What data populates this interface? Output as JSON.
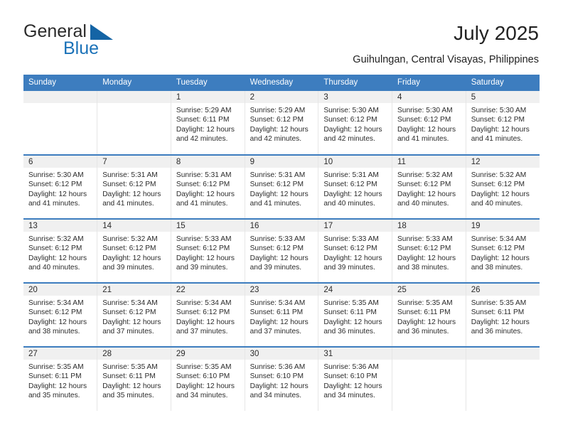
{
  "brand": {
    "name_part1": "General",
    "name_part2": "Blue",
    "triangle_color": "#1464a5",
    "blue": "#1b72b8"
  },
  "header": {
    "title": "July 2025",
    "subtitle": "Guihulngan, Central Visayas, Philippines"
  },
  "theme": {
    "header_blue": "#3d7dbf",
    "daynum_strip": "#f0f0f0",
    "text": "#2b2b2b"
  },
  "weekdays": [
    "Sunday",
    "Monday",
    "Tuesday",
    "Wednesday",
    "Thursday",
    "Friday",
    "Saturday"
  ],
  "labels": {
    "sunrise": "Sunrise:",
    "sunset": "Sunset:",
    "daylight": "Daylight:"
  },
  "weeks": [
    [
      {
        "day": "",
        "sunrise": "",
        "sunset": "",
        "daylight1": "",
        "daylight2": ""
      },
      {
        "day": "",
        "sunrise": "",
        "sunset": "",
        "daylight1": "",
        "daylight2": ""
      },
      {
        "day": "1",
        "sunrise": "Sunrise: 5:29 AM",
        "sunset": "Sunset: 6:11 PM",
        "daylight1": "Daylight: 12 hours",
        "daylight2": "and 42 minutes."
      },
      {
        "day": "2",
        "sunrise": "Sunrise: 5:29 AM",
        "sunset": "Sunset: 6:12 PM",
        "daylight1": "Daylight: 12 hours",
        "daylight2": "and 42 minutes."
      },
      {
        "day": "3",
        "sunrise": "Sunrise: 5:30 AM",
        "sunset": "Sunset: 6:12 PM",
        "daylight1": "Daylight: 12 hours",
        "daylight2": "and 42 minutes."
      },
      {
        "day": "4",
        "sunrise": "Sunrise: 5:30 AM",
        "sunset": "Sunset: 6:12 PM",
        "daylight1": "Daylight: 12 hours",
        "daylight2": "and 41 minutes."
      },
      {
        "day": "5",
        "sunrise": "Sunrise: 5:30 AM",
        "sunset": "Sunset: 6:12 PM",
        "daylight1": "Daylight: 12 hours",
        "daylight2": "and 41 minutes."
      }
    ],
    [
      {
        "day": "6",
        "sunrise": "Sunrise: 5:30 AM",
        "sunset": "Sunset: 6:12 PM",
        "daylight1": "Daylight: 12 hours",
        "daylight2": "and 41 minutes."
      },
      {
        "day": "7",
        "sunrise": "Sunrise: 5:31 AM",
        "sunset": "Sunset: 6:12 PM",
        "daylight1": "Daylight: 12 hours",
        "daylight2": "and 41 minutes."
      },
      {
        "day": "8",
        "sunrise": "Sunrise: 5:31 AM",
        "sunset": "Sunset: 6:12 PM",
        "daylight1": "Daylight: 12 hours",
        "daylight2": "and 41 minutes."
      },
      {
        "day": "9",
        "sunrise": "Sunrise: 5:31 AM",
        "sunset": "Sunset: 6:12 PM",
        "daylight1": "Daylight: 12 hours",
        "daylight2": "and 41 minutes."
      },
      {
        "day": "10",
        "sunrise": "Sunrise: 5:31 AM",
        "sunset": "Sunset: 6:12 PM",
        "daylight1": "Daylight: 12 hours",
        "daylight2": "and 40 minutes."
      },
      {
        "day": "11",
        "sunrise": "Sunrise: 5:32 AM",
        "sunset": "Sunset: 6:12 PM",
        "daylight1": "Daylight: 12 hours",
        "daylight2": "and 40 minutes."
      },
      {
        "day": "12",
        "sunrise": "Sunrise: 5:32 AM",
        "sunset": "Sunset: 6:12 PM",
        "daylight1": "Daylight: 12 hours",
        "daylight2": "and 40 minutes."
      }
    ],
    [
      {
        "day": "13",
        "sunrise": "Sunrise: 5:32 AM",
        "sunset": "Sunset: 6:12 PM",
        "daylight1": "Daylight: 12 hours",
        "daylight2": "and 40 minutes."
      },
      {
        "day": "14",
        "sunrise": "Sunrise: 5:32 AM",
        "sunset": "Sunset: 6:12 PM",
        "daylight1": "Daylight: 12 hours",
        "daylight2": "and 39 minutes."
      },
      {
        "day": "15",
        "sunrise": "Sunrise: 5:33 AM",
        "sunset": "Sunset: 6:12 PM",
        "daylight1": "Daylight: 12 hours",
        "daylight2": "and 39 minutes."
      },
      {
        "day": "16",
        "sunrise": "Sunrise: 5:33 AM",
        "sunset": "Sunset: 6:12 PM",
        "daylight1": "Daylight: 12 hours",
        "daylight2": "and 39 minutes."
      },
      {
        "day": "17",
        "sunrise": "Sunrise: 5:33 AM",
        "sunset": "Sunset: 6:12 PM",
        "daylight1": "Daylight: 12 hours",
        "daylight2": "and 39 minutes."
      },
      {
        "day": "18",
        "sunrise": "Sunrise: 5:33 AM",
        "sunset": "Sunset: 6:12 PM",
        "daylight1": "Daylight: 12 hours",
        "daylight2": "and 38 minutes."
      },
      {
        "day": "19",
        "sunrise": "Sunrise: 5:34 AM",
        "sunset": "Sunset: 6:12 PM",
        "daylight1": "Daylight: 12 hours",
        "daylight2": "and 38 minutes."
      }
    ],
    [
      {
        "day": "20",
        "sunrise": "Sunrise: 5:34 AM",
        "sunset": "Sunset: 6:12 PM",
        "daylight1": "Daylight: 12 hours",
        "daylight2": "and 38 minutes."
      },
      {
        "day": "21",
        "sunrise": "Sunrise: 5:34 AM",
        "sunset": "Sunset: 6:12 PM",
        "daylight1": "Daylight: 12 hours",
        "daylight2": "and 37 minutes."
      },
      {
        "day": "22",
        "sunrise": "Sunrise: 5:34 AM",
        "sunset": "Sunset: 6:12 PM",
        "daylight1": "Daylight: 12 hours",
        "daylight2": "and 37 minutes."
      },
      {
        "day": "23",
        "sunrise": "Sunrise: 5:34 AM",
        "sunset": "Sunset: 6:11 PM",
        "daylight1": "Daylight: 12 hours",
        "daylight2": "and 37 minutes."
      },
      {
        "day": "24",
        "sunrise": "Sunrise: 5:35 AM",
        "sunset": "Sunset: 6:11 PM",
        "daylight1": "Daylight: 12 hours",
        "daylight2": "and 36 minutes."
      },
      {
        "day": "25",
        "sunrise": "Sunrise: 5:35 AM",
        "sunset": "Sunset: 6:11 PM",
        "daylight1": "Daylight: 12 hours",
        "daylight2": "and 36 minutes."
      },
      {
        "day": "26",
        "sunrise": "Sunrise: 5:35 AM",
        "sunset": "Sunset: 6:11 PM",
        "daylight1": "Daylight: 12 hours",
        "daylight2": "and 36 minutes."
      }
    ],
    [
      {
        "day": "27",
        "sunrise": "Sunrise: 5:35 AM",
        "sunset": "Sunset: 6:11 PM",
        "daylight1": "Daylight: 12 hours",
        "daylight2": "and 35 minutes."
      },
      {
        "day": "28",
        "sunrise": "Sunrise: 5:35 AM",
        "sunset": "Sunset: 6:11 PM",
        "daylight1": "Daylight: 12 hours",
        "daylight2": "and 35 minutes."
      },
      {
        "day": "29",
        "sunrise": "Sunrise: 5:35 AM",
        "sunset": "Sunset: 6:10 PM",
        "daylight1": "Daylight: 12 hours",
        "daylight2": "and 34 minutes."
      },
      {
        "day": "30",
        "sunrise": "Sunrise: 5:36 AM",
        "sunset": "Sunset: 6:10 PM",
        "daylight1": "Daylight: 12 hours",
        "daylight2": "and 34 minutes."
      },
      {
        "day": "31",
        "sunrise": "Sunrise: 5:36 AM",
        "sunset": "Sunset: 6:10 PM",
        "daylight1": "Daylight: 12 hours",
        "daylight2": "and 34 minutes."
      },
      {
        "day": "",
        "sunrise": "",
        "sunset": "",
        "daylight1": "",
        "daylight2": ""
      },
      {
        "day": "",
        "sunrise": "",
        "sunset": "",
        "daylight1": "",
        "daylight2": ""
      }
    ]
  ]
}
